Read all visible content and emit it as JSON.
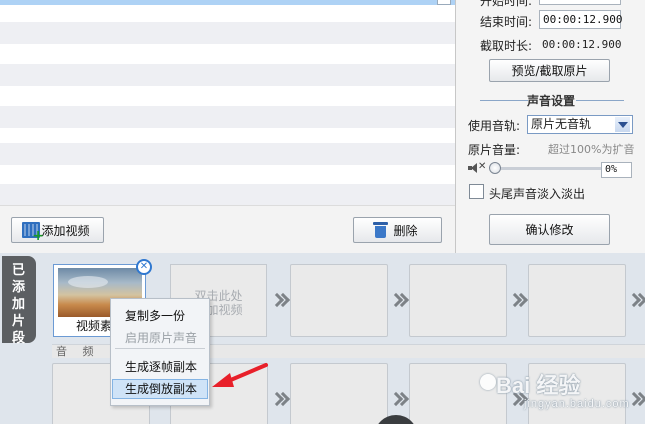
{
  "settings": {
    "start_label": "开始时间:",
    "end_label": "结束时间:",
    "end_value": "00:00:12.900",
    "duration_label": "截取时长:",
    "duration_value": "00:00:12.900",
    "preview_button": "预览/截取原片",
    "sound_section_title": "声音设置",
    "track_label": "使用音轨:",
    "track_selected": "原片无音轨",
    "volume_label": "原片音量:",
    "volume_hint": "超过100%为扩音",
    "volume_value": "0%",
    "fade_label": "头尾声音淡入淡出",
    "fade_checked": false,
    "confirm_button": "确认修改"
  },
  "list_toolbar": {
    "add_video": "添加视频",
    "delete": "删除"
  },
  "timeline": {
    "side_tab": [
      "已",
      "添",
      "加",
      "片",
      "段"
    ],
    "clip_name": "视频素材",
    "add_slot_text": [
      "双击此处",
      "添加视频"
    ],
    "audio_label": "音 频"
  },
  "context_menu": {
    "items": [
      {
        "label": "复制多一份",
        "enabled": true
      },
      {
        "label": "启用原片声音",
        "enabled": false
      },
      {
        "label": "生成逐帧副本",
        "enabled": true
      },
      {
        "label": "生成倒放副本",
        "enabled": true,
        "highlighted": true
      }
    ]
  },
  "watermark": {
    "logo": "Bai 经验",
    "sub": "jingyan.baidu.com"
  },
  "colors": {
    "accent": "#2f78d0",
    "annotation_arrow": "#e8202a",
    "menu_highlight": "#cfe3f7"
  }
}
